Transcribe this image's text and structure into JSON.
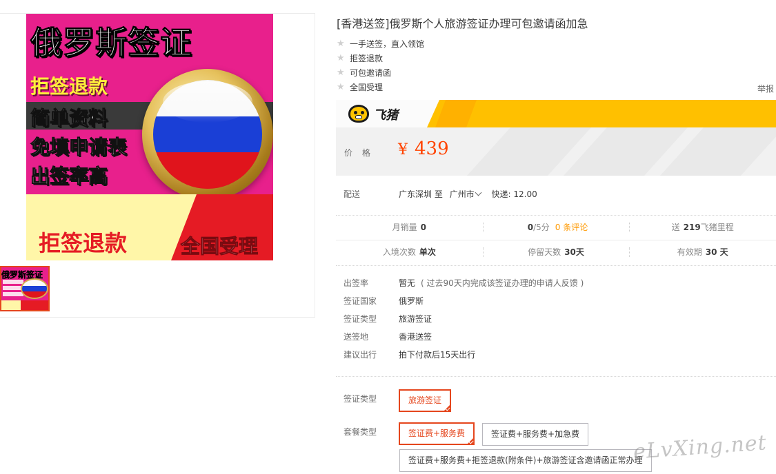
{
  "gallery": {
    "main_image": {
      "title_text": "俄罗斯签证",
      "refund_text": "拒签退款",
      "line1": "简单资料",
      "line2": "免填申请表",
      "line3": "出签率高",
      "bottom_left": "拒签退款",
      "bottom_right": "全国受理"
    },
    "thumbnail": {
      "title_text": "俄罗斯签证"
    }
  },
  "product": {
    "title": "[香港送签]俄罗斯个人旅游签证办理可包邀请函加急",
    "features": [
      "一手送签，直入领馆",
      "拒签退款",
      "可包邀请函",
      "全国受理"
    ],
    "report_link": "举报"
  },
  "brand": {
    "name": "飞猪",
    "logo_icon": "fliggy-pig-logo"
  },
  "price": {
    "label": "价格",
    "currency": "¥",
    "value": "439"
  },
  "shipping": {
    "label": "配送",
    "from": "广东深圳",
    "to_word": "至",
    "destination": "广州市",
    "fee_label": "快递:",
    "fee": "12.00"
  },
  "stats": {
    "row1": {
      "monthly_sales_label": "月销量",
      "monthly_sales": "0",
      "rating": "0",
      "rating_total": "/5分",
      "reviews": "0 条评论",
      "mileage_prefix": "送",
      "mileage": "219",
      "mileage_suffix": "飞猪里程"
    },
    "row2": {
      "entries_label": "入境次数",
      "entries": "单次",
      "stay_label": "停留天数",
      "stay": "30天",
      "validity_label": "有效期",
      "validity": "30 天"
    }
  },
  "info": [
    {
      "key": "出签率",
      "value": "暂无",
      "hint": "( 过去90天内完成该签证办理的申请人反馈 )"
    },
    {
      "key": "签证国家",
      "value": "俄罗斯",
      "hint": ""
    },
    {
      "key": "签证类型",
      "value": "旅游签证",
      "hint": ""
    },
    {
      "key": "送签地",
      "value": "香港送签",
      "hint": ""
    },
    {
      "key": "建议出行",
      "value": "拍下付款后15天出行",
      "hint": ""
    }
  ],
  "sku": {
    "visa_type_label": "签证类型",
    "visa_type_options": [
      "旅游签证"
    ],
    "package_label": "套餐类型",
    "package_options": [
      "签证费+服务费",
      "签证费+服务费+加急费",
      "签证费+服务费+拒签退款(附条件)+旅游签证含邀请函正常办理"
    ]
  },
  "watermark": "eLvXing.net",
  "colors": {
    "accent": "#ff4400",
    "selected_border": "#e5461d",
    "brand_yellow": "#ffc000",
    "highlight_orange": "#ff9900"
  }
}
